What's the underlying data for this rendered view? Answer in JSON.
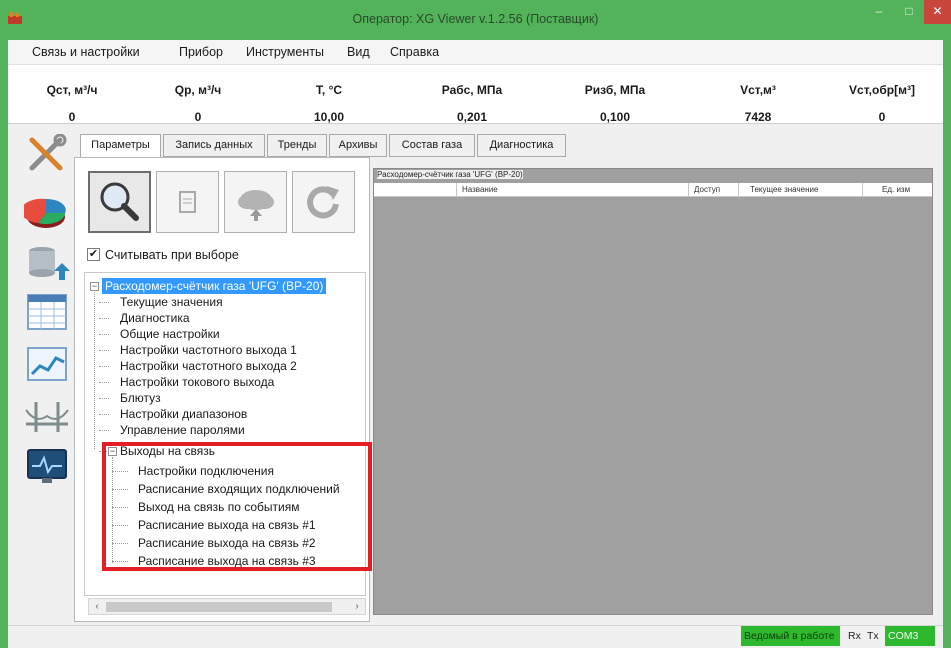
{
  "window": {
    "title": "Оператор: XG Viewer v.1.2.56 (Поставщик)",
    "minimize_glyph": "–",
    "maximize_glyph": "□",
    "close_glyph": "✕"
  },
  "menu": [
    "Связь и настройки",
    "Прибор",
    "Инструменты",
    "Вид",
    "Справка"
  ],
  "params": [
    {
      "label": "Qст, м³/ч",
      "value": "0"
    },
    {
      "label": "Qр, м³/ч",
      "value": "0"
    },
    {
      "label": "T, °C",
      "value": "10,00"
    },
    {
      "label": "Рабс, МПа",
      "value": "0,201"
    },
    {
      "label": "Ризб, МПа",
      "value": "0,100"
    },
    {
      "label": "Vст,м³",
      "value": "7428"
    },
    {
      "label": "Vст,обр[м³]",
      "value": "0"
    }
  ],
  "sidebar_icons": [
    "tools-icon",
    "pie-chart-icon",
    "database-upload-icon",
    "table-icon",
    "trend-chart-icon",
    "bridge-icon",
    "monitor-pulse-icon"
  ],
  "tabs": [
    {
      "label": "Параметры",
      "active": true
    },
    {
      "label": "Запись данных",
      "active": false
    },
    {
      "label": "Тренды",
      "active": false
    },
    {
      "label": "Архивы",
      "active": false
    },
    {
      "label": "Состав газа",
      "active": false
    },
    {
      "label": "Диагностика",
      "active": false
    }
  ],
  "toolbar": {
    "buttons": [
      "search-icon",
      "document-icon",
      "cloud-upload-icon",
      "refresh-icon"
    ]
  },
  "read_on_select": {
    "label": "Считывать при выборе",
    "checked": true,
    "check_glyph": "✔"
  },
  "tree": {
    "root": "Расходомер-счётчик газа 'UFG' (BP-20)",
    "expand_glyph": "−",
    "children": [
      "Текущие значения",
      "Диагностика",
      "Общие настройки",
      "Настройки частотного выхода 1",
      "Настройки частотного выхода 2",
      "Настройки токового выхода",
      "Блютуз",
      "Настройки диапазонов",
      "Управление паролями"
    ],
    "group": {
      "label": "Выходы на связь",
      "children": [
        "Настройки подключения",
        "Расписание входящих подключений",
        "Выход на связь по событиям",
        "Расписание выхода на связь #1",
        "Расписание выхода на связь #2",
        "Расписание выхода на связь #3"
      ]
    }
  },
  "hscroll": {
    "left_glyph": "‹",
    "right_glyph": "›"
  },
  "grid": {
    "caption": "Расходомер-счётчик газа 'UFG' (BP-20)",
    "columns": [
      "Название",
      "Доступ",
      "Текущее значение",
      "Ед. изм"
    ]
  },
  "status": {
    "work": "Ведомый в работе",
    "rx": "Rx",
    "tx": "Tx",
    "port": "COM3"
  },
  "colors": {
    "window_frame": "#52b35a",
    "highlight": "#e41e26",
    "selection": "#3399ff",
    "status_ok": "#2eb82e"
  }
}
